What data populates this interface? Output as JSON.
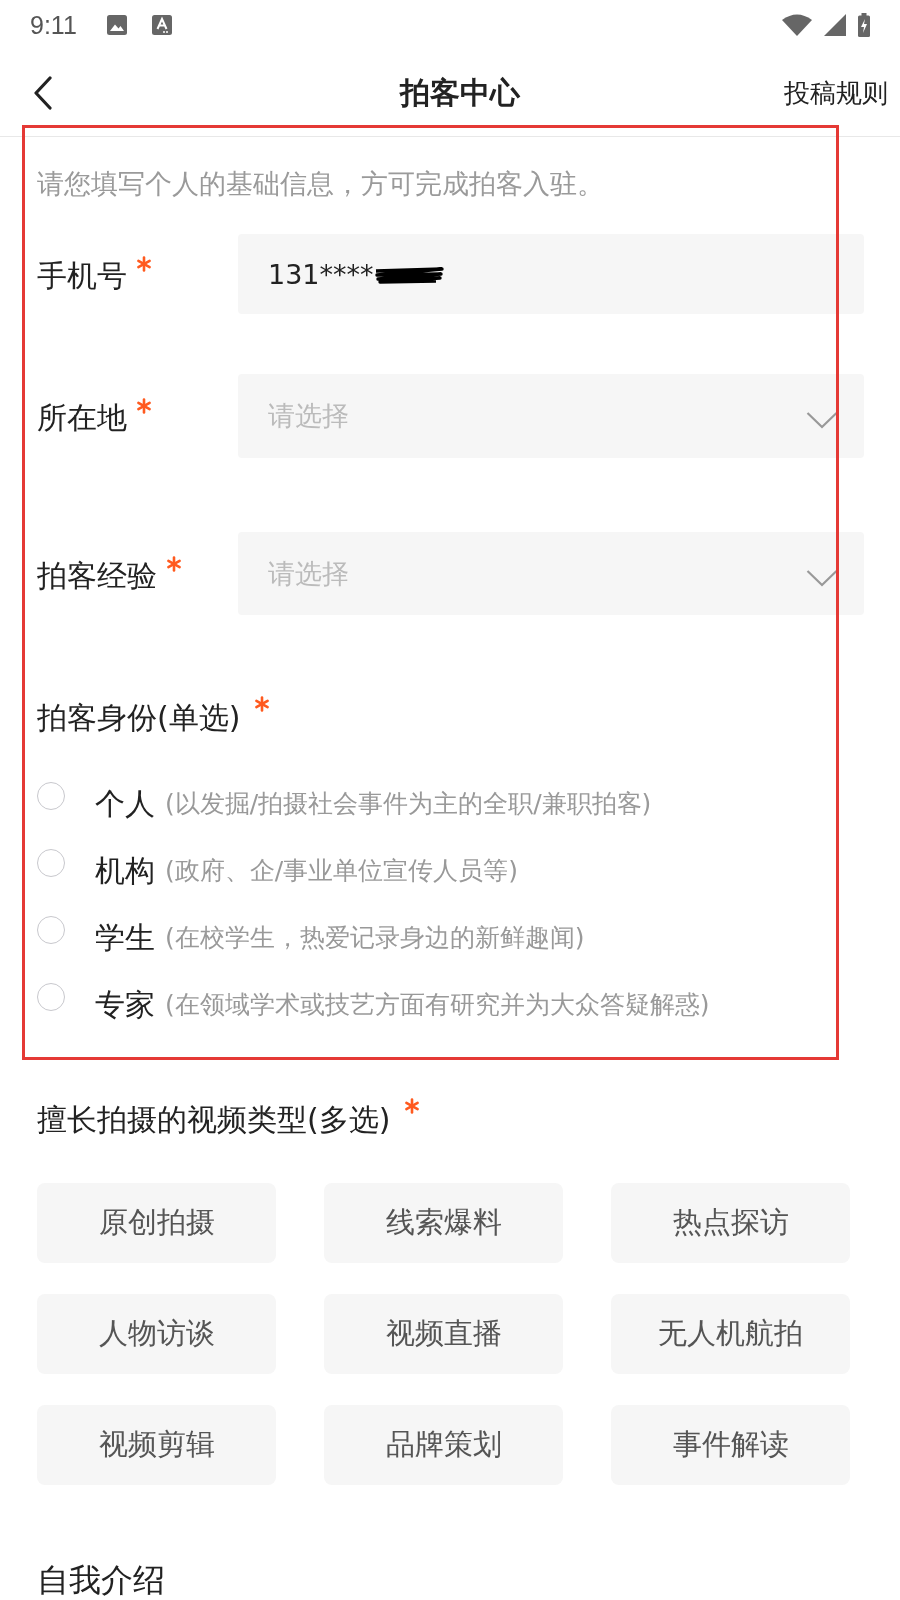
{
  "status_bar": {
    "time": "9:11"
  },
  "header": {
    "title": "拍客中心",
    "action": "投稿规则"
  },
  "intro": "请您填写个人的基础信息，方可完成拍客入驻。",
  "fields": [
    {
      "kind": "text",
      "label": "手机号",
      "required": true,
      "value": "131****",
      "redacted": true
    },
    {
      "kind": "select",
      "label": "所在地",
      "required": true,
      "placeholder": "请选择"
    },
    {
      "kind": "select",
      "label": "拍客经验",
      "required": true,
      "placeholder": "请选择"
    }
  ],
  "identity": {
    "title": "拍客身份(单选)",
    "required": true,
    "options": [
      {
        "label": "个人",
        "description": "(以发掘/拍摄社会事件为主的全职/兼职拍客)",
        "selected": false
      },
      {
        "label": "机构",
        "description": "(政府、企/事业单位宣传人员等)",
        "selected": false
      },
      {
        "label": "学生",
        "description": "(在校学生，热爱记录身边的新鲜趣闻)",
        "selected": false
      },
      {
        "label": "专家",
        "description": "(在领域学术或技艺方面有研究并为大众答疑解惑)",
        "selected": false
      }
    ]
  },
  "video_types": {
    "title": "擅长拍摄的视频类型(多选)",
    "required": true,
    "tags": [
      {
        "label": "原创拍摄",
        "selected": false
      },
      {
        "label": "线索爆料",
        "selected": false
      },
      {
        "label": "热点探访",
        "selected": false
      },
      {
        "label": "人物访谈",
        "selected": false
      },
      {
        "label": "视频直播",
        "selected": false
      },
      {
        "label": "无人机航拍",
        "selected": false
      },
      {
        "label": "视频剪辑",
        "selected": false
      },
      {
        "label": "品牌策划",
        "selected": false
      },
      {
        "label": "事件解读",
        "selected": false
      }
    ]
  },
  "self_intro": {
    "title": "自我介绍"
  }
}
